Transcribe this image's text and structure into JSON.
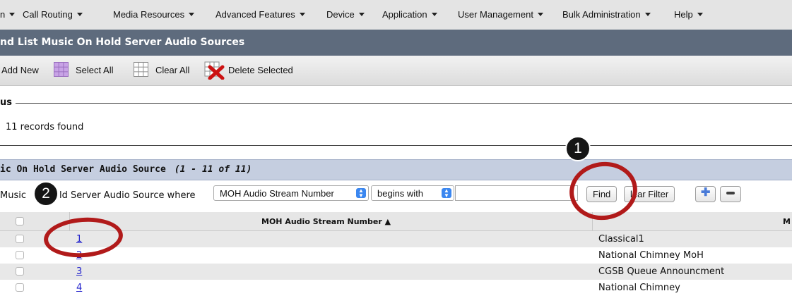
{
  "menu": [
    {
      "label": "n"
    },
    {
      "label": "Call Routing"
    },
    {
      "label": "Media Resources"
    },
    {
      "label": "Advanced Features"
    },
    {
      "label": "Device"
    },
    {
      "label": "Application"
    },
    {
      "label": "User Management"
    },
    {
      "label": "Bulk Administration"
    },
    {
      "label": "Help"
    }
  ],
  "page_title": "nd List Music On Hold Server Audio Sources",
  "toolbar": {
    "add_new": "Add New",
    "select_all": "Select All",
    "clear_all": "Clear All",
    "delete_selected": "Delete Selected"
  },
  "status": {
    "label": "us",
    "text": "11 records found"
  },
  "section": {
    "title": "ic On Hold Server Audio Source",
    "count": "(1 - 11 of 11)"
  },
  "find": {
    "label_left": "Music",
    "label_right": "ld Server Audio Source where",
    "field_select": "MOH Audio Stream Number",
    "operator_select": "begins with",
    "search_value": "",
    "find_button": "Find",
    "clear_filter_button": "lear Filter",
    "add_icon": "plus-icon",
    "remove_icon": "minus-icon"
  },
  "table": {
    "columns": [
      "MOH Audio Stream Number",
      "M"
    ],
    "rows": [
      {
        "number": "1",
        "description": "Classical1"
      },
      {
        "number": "2",
        "description": "National Chimney MoH"
      },
      {
        "number": "3",
        "description": "CGSB Queue Announcment"
      },
      {
        "number": "4",
        "description": "National Chimney"
      }
    ]
  },
  "annotations": {
    "badge_1": "1",
    "badge_2": "2",
    "ring_color": "#b11a1a"
  },
  "colors": {
    "title_bar": "#5e6b7d",
    "section_header": "#c5cee0",
    "link": "#2222cc"
  }
}
